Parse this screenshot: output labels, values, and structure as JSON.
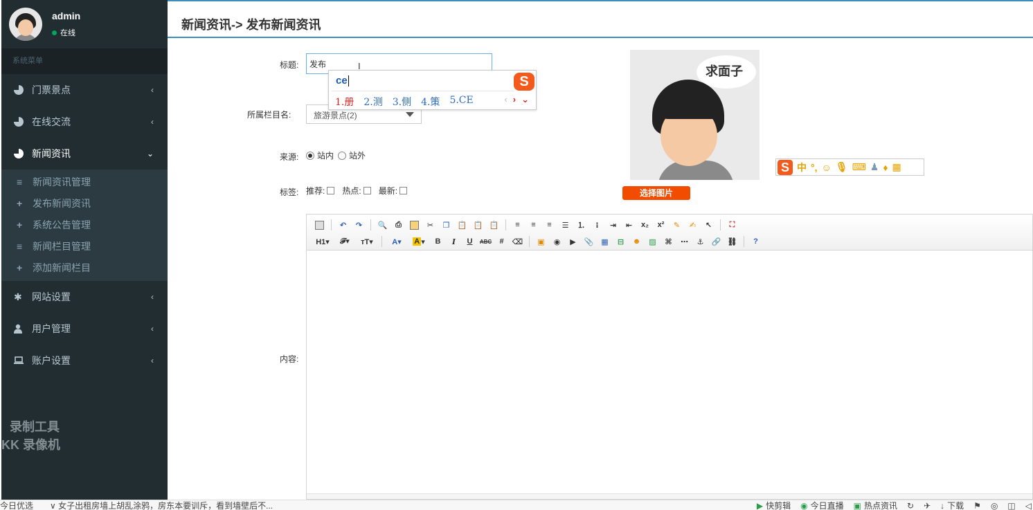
{
  "user": {
    "name": "admin",
    "status": "在线"
  },
  "sidebar": {
    "header": "系统菜单",
    "items": [
      {
        "label": "门票景点",
        "icon": "pie-chart-icon",
        "expanded": false
      },
      {
        "label": "在线交流",
        "icon": "pie-chart-icon",
        "expanded": false
      },
      {
        "label": "新闻资讯",
        "icon": "pie-chart-icon",
        "expanded": true
      },
      {
        "label": "网站设置",
        "icon": "gear-icon",
        "expanded": false
      },
      {
        "label": "用户管理",
        "icon": "user-icon",
        "expanded": false
      },
      {
        "label": "账户设置",
        "icon": "laptop-icon",
        "expanded": false
      }
    ],
    "submenu": [
      {
        "label": "新闻资讯管理",
        "icon": "list-icon"
      },
      {
        "label": "发布新闻资讯",
        "icon": "plus-icon"
      },
      {
        "label": "系统公告管理",
        "icon": "plus-icon"
      },
      {
        "label": "新闻栏目管理",
        "icon": "list-icon"
      },
      {
        "label": "添加新闻栏目",
        "icon": "plus-icon"
      }
    ]
  },
  "watermark": {
    "line1": "录制工具",
    "line2": "KK 录像机"
  },
  "page": {
    "title": "新闻资讯-> 发布新闻资讯"
  },
  "form": {
    "title_label": "标题:",
    "title_value": "发布",
    "category_label": "所属栏目名:",
    "category_value": "旅游景点(2)",
    "source_label": "来源:",
    "source_options": [
      "站内",
      "站外"
    ],
    "source_selected": "站内",
    "tags_label": "标签:",
    "tags": [
      "推荐:",
      "热点:",
      "最新:"
    ],
    "content_label": "内容:"
  },
  "preview": {
    "bubble_text": "求面子",
    "select_button": "选择图片"
  },
  "ime": {
    "input": "ce",
    "candidates": [
      "1.册",
      "2.测",
      "3.侧",
      "4.策",
      "5.CE"
    ],
    "bar_lang": "中"
  },
  "statusbar": {
    "left": "今日优选",
    "news": "∨ 女子出租房墙上胡乱涂鸦，房东本要训斥，看到墙壁后不...",
    "right": [
      "快剪辑",
      "今日直播",
      "热点资讯",
      "下载"
    ]
  },
  "colors": {
    "sidebar_bg": "#222d32",
    "accent": "#3c8dbc",
    "button": "#f24c00"
  }
}
